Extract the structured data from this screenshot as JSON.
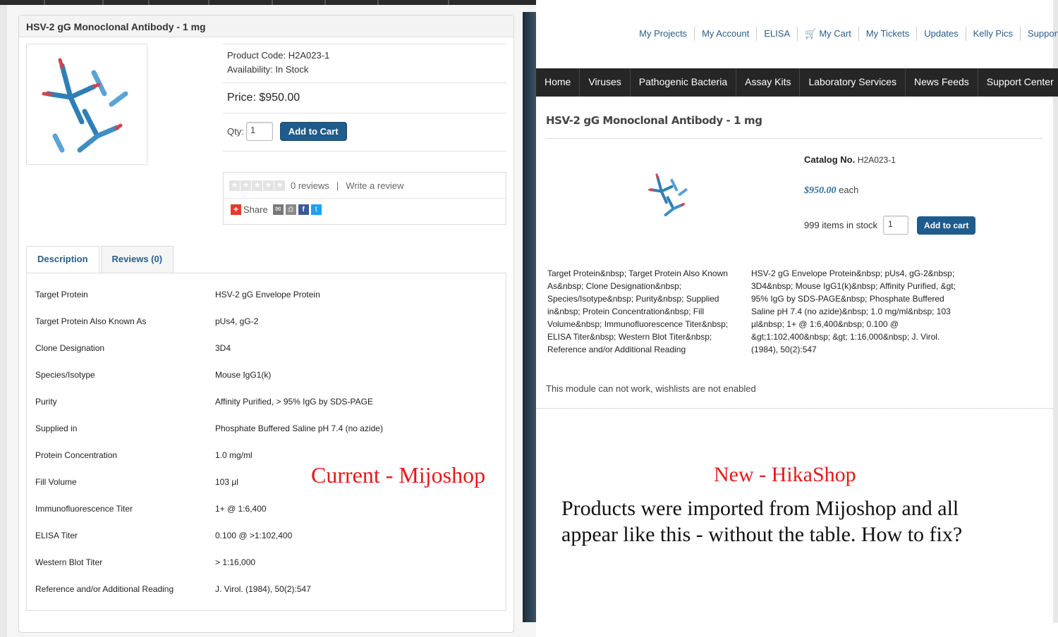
{
  "left": {
    "annotation": "Current - Mijoshop",
    "product_title": "HSV-2 gG Monoclonal Antibody - 1 mg",
    "product_code": "Product Code: H2A023-1",
    "availability": "Availability: In Stock",
    "price": "Price: $950.00",
    "qty_label": "Qty:",
    "qty_value": "1",
    "add_to_cart": "Add to Cart",
    "reviews_count": "0 reviews",
    "sep": "|",
    "write_review": "Write a review",
    "share": "Share",
    "tabs": [
      "Description",
      "Reviews (0)"
    ],
    "specs": [
      {
        "k": "Target Protein",
        "v": "HSV-2 gG Envelope Protein"
      },
      {
        "k": "Target Protein Also Known As",
        "v": "pUs4, gG-2"
      },
      {
        "k": "Clone Designation",
        "v": "3D4"
      },
      {
        "k": "Species/Isotype",
        "v": "Mouse IgG1(k)"
      },
      {
        "k": "Purity",
        "v": "Affinity Purified, > 95% IgG by SDS-PAGE"
      },
      {
        "k": "Supplied in",
        "v": "Phosphate Buffered Saline pH 7.4 (no azide)"
      },
      {
        "k": "Protein Concentration",
        "v": "1.0 mg/ml"
      },
      {
        "k": "Fill Volume",
        "v": "103 µl"
      },
      {
        "k": "Immunofluorescence Titer",
        "v": "1+ @ 1:6,400"
      },
      {
        "k": "ELISA Titer",
        "v": "0.100 @ >1:102,400"
      },
      {
        "k": "Western Blot Titer",
        "v": "> 1:16,000"
      },
      {
        "k": "Reference and/or Additional Reading",
        "v": "J. Virol. (1984), 50(2):547"
      }
    ]
  },
  "right": {
    "top_links": [
      "My Projects",
      "My Account",
      "ELISA",
      "My Cart",
      "My Tickets",
      "Updates",
      "Kelly Pics",
      "Support"
    ],
    "nav": [
      "Home",
      "Viruses",
      "Pathogenic Bacteria",
      "Assay Kits",
      "Laboratory Services",
      "News Feeds",
      "Support Center"
    ],
    "product_title": "HSV-2 gG Monoclonal Antibody - 1 mg",
    "catalog_label": "Catalog No.",
    "catalog_value": "H2A023-1",
    "price": "$950.00",
    "price_unit": "each",
    "stock": "999 items in stock",
    "qty_value": "1",
    "add_to_cart": "Add to cart",
    "desc_keys": "Target Protein&nbsp; Target Protein Also Known As&nbsp; Clone Designation&nbsp; Species/Isotype&nbsp; Purity&nbsp; Supplied in&nbsp; Protein Concentration&nbsp; Fill Volume&nbsp; Immunofluorescence Titer&nbsp; ELISA Titer&nbsp; Western Blot Titer&nbsp; Reference and/or Additional Reading",
    "desc_values": "HSV-2 gG Envelope Protein&nbsp; pUs4, gG-2&nbsp; 3D4&nbsp; Mouse IgG1(k)&nbsp; Affinity Purified, &gt; 95% IgG by SDS-PAGE&nbsp; Phosphate Buffered Saline pH 7.4 (no azide)&nbsp; 1.0 mg/ml&nbsp; 103 µl&nbsp; 1+ @ 1:6,400&nbsp; 0.100 @ &gt;1:102,400&nbsp; &gt; 1:16,000&nbsp; J. Virol. (1984), 50(2):547",
    "wishlist_msg": "This module can not work, wishlists are not enabled",
    "annotation_new": "New - HikaShop",
    "annotation_question": "Products were imported from Mijoshop and all appear like this - without the table. How to fix?"
  }
}
